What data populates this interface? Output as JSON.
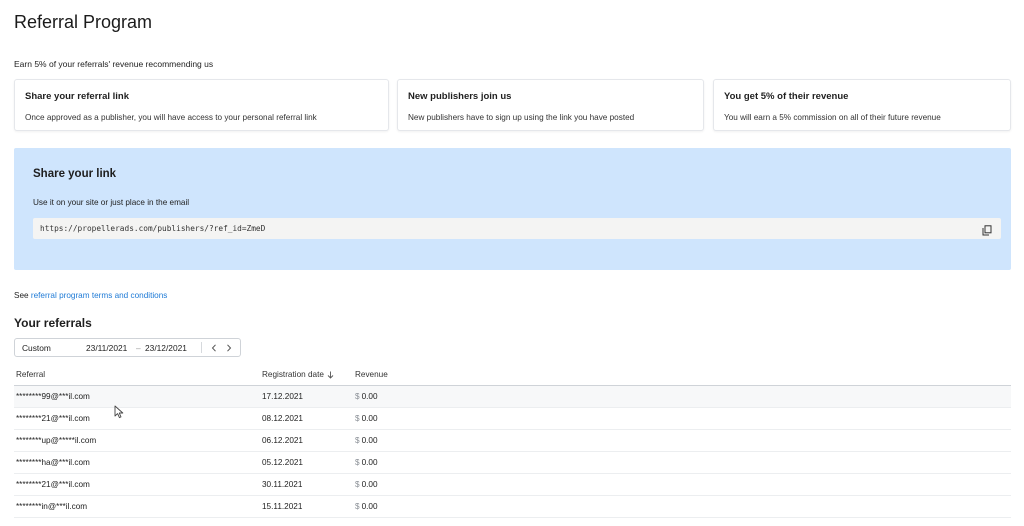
{
  "page": {
    "title": "Referral Program",
    "subtitle": "Earn 5% of your referrals' revenue recommending us"
  },
  "steps": [
    {
      "title": "Share your referral link",
      "text": "Once approved as a publisher, you will have access to your personal referral link"
    },
    {
      "title": "New publishers join us",
      "text": "New publishers have to sign up using the link you have posted"
    },
    {
      "title": "You get 5% of their revenue",
      "text": "You will earn a 5% commission on all of their future revenue"
    }
  ],
  "share": {
    "title": "Share your link",
    "description": "Use it on your site or just place in the email",
    "link": "https://propellerads.com/publishers/?ref_id=ZmeD",
    "copy_icon": "copy-icon"
  },
  "terms": {
    "prefix": "See",
    "link_text": "referral program terms and conditions"
  },
  "referrals": {
    "title": "Your referrals",
    "date_filter": {
      "range_type": "Custom",
      "from": "23/11/2021",
      "dash": "–",
      "to": "23/12/2021",
      "prev_icon": "chevron-left-icon",
      "next_icon": "chevron-right-icon"
    },
    "columns": {
      "referral": "Referral",
      "registration_date": "Registration date",
      "revenue": "Revenue"
    },
    "sort_icon": "arrow-down-icon",
    "currency_symbol": "$",
    "rows": [
      {
        "referral": "********99@***il.com",
        "date": "17.12.2021",
        "revenue": "0.00"
      },
      {
        "referral": "********21@***il.com",
        "date": "08.12.2021",
        "revenue": "0.00"
      },
      {
        "referral": "********up@*****il.com",
        "date": "06.12.2021",
        "revenue": "0.00"
      },
      {
        "referral": "********ha@***il.com",
        "date": "05.12.2021",
        "revenue": "0.00"
      },
      {
        "referral": "********21@***il.com",
        "date": "30.11.2021",
        "revenue": "0.00"
      },
      {
        "referral": "********in@***il.com",
        "date": "15.11.2021",
        "revenue": "0.00"
      }
    ]
  },
  "colors": {
    "share_background": "#cfe5fd",
    "link_color": "#1e7ad6"
  }
}
